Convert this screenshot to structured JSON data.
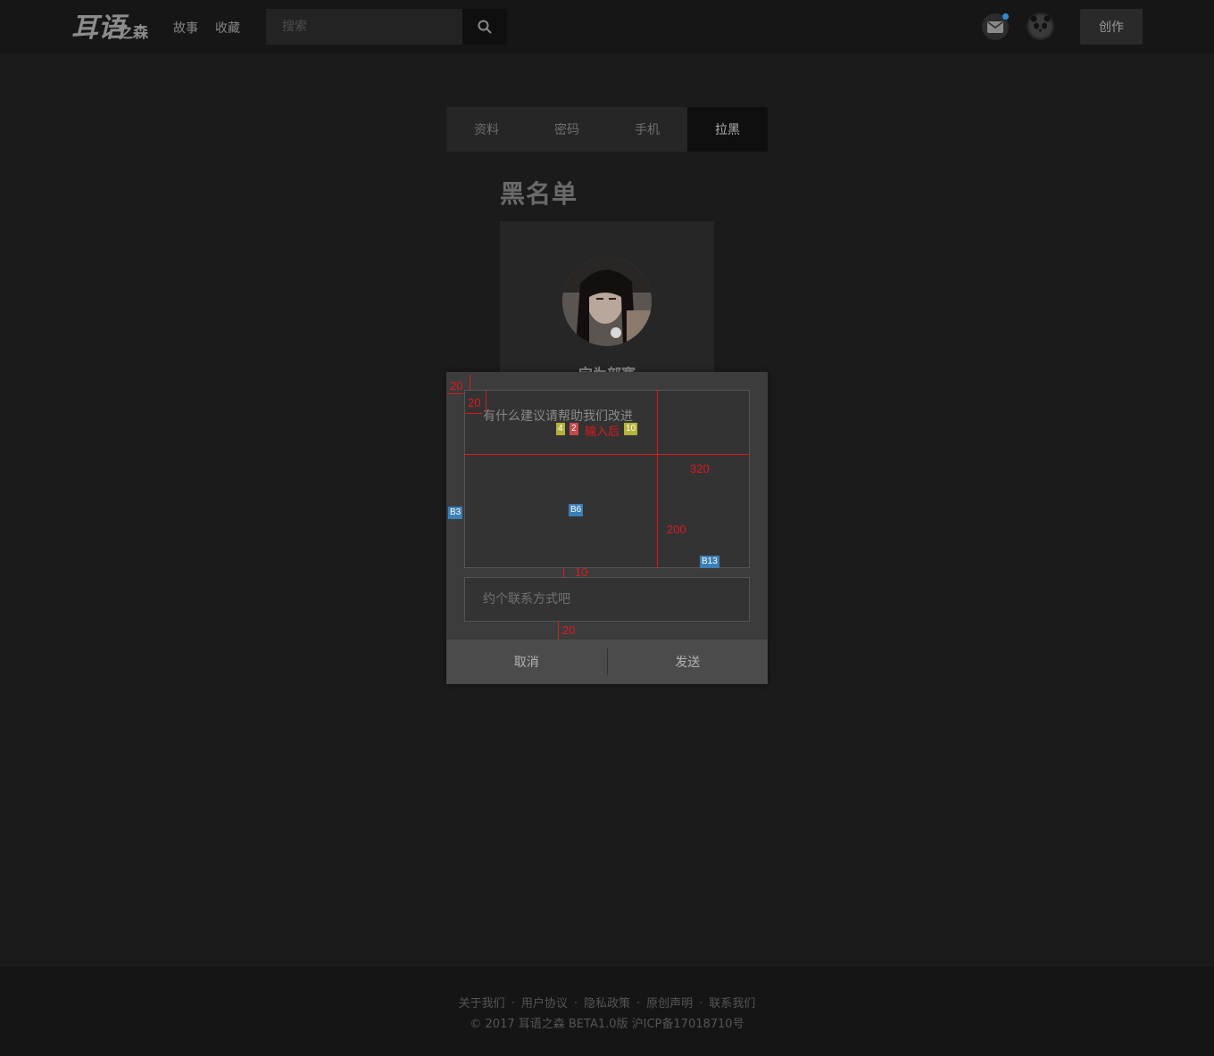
{
  "header": {
    "logo_text": "耳语之森",
    "nav": [
      "故事",
      "收藏"
    ],
    "search_placeholder": "搜索",
    "create_label": "创作",
    "accent_dot_color": "#2b8bd6"
  },
  "settings_tabs": [
    "资料",
    "密码",
    "手机",
    "拉黑"
  ],
  "active_tab": "拉黑",
  "page_title": "黑名单",
  "blocked_user": {
    "name": "宝为部赛"
  },
  "modal": {
    "feedback_placeholder": "有什么建议请帮助我们改进",
    "contact_placeholder": "约个联系方式吧",
    "cancel_label": "取消",
    "send_label": "发送"
  },
  "annotations": {
    "measure_20_a": "20",
    "measure_20_b": "20",
    "measure_320": "320",
    "measure_200": "200",
    "measure_10": "10",
    "measure_20_c": "20",
    "chip_4": "4",
    "chip_2": "2",
    "input_after": "输入后",
    "chip_10": "10",
    "chip_b3": "B3",
    "chip_b6": "B6",
    "chip_b13": "B13",
    "annotation_color": "#e0191c"
  },
  "footer": {
    "links": [
      "关于我们",
      "用户协议",
      "隐私政策",
      "原创声明",
      "联系我们"
    ],
    "separator": "·",
    "copyright": "© 2017 耳语之森 BETA1.0版 沪ICP备17018710号"
  }
}
